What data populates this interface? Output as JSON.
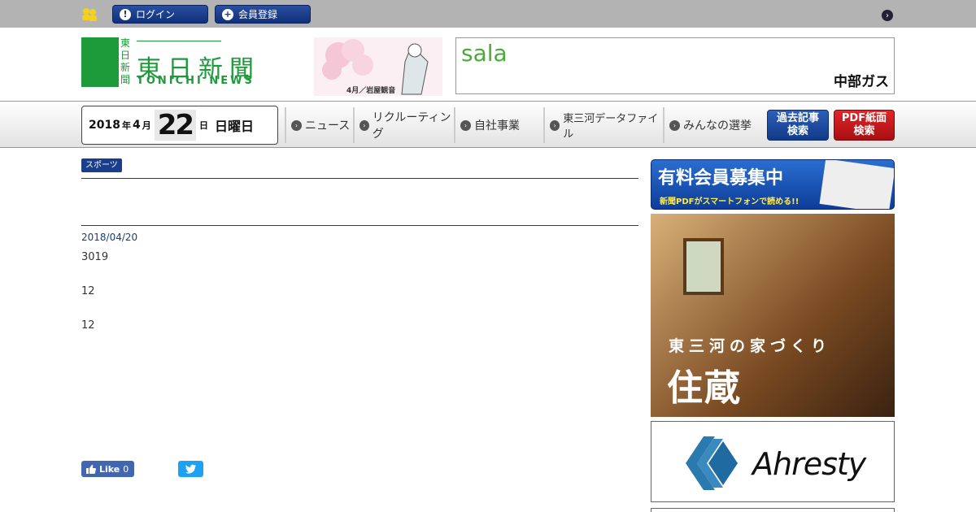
{
  "topbar": {
    "login_label": "ログイン",
    "register_label": "会員登録"
  },
  "logo": {
    "vertical": [
      "東",
      "日",
      "新",
      "聞"
    ],
    "main": "東日新聞",
    "sub": "TONICHI NEWS"
  },
  "illustration": {
    "caption": "4月／岩屋観音"
  },
  "banner": {
    "left_text": "sala",
    "right_text": "中部ガス"
  },
  "date": {
    "year": "2018",
    "year_suffix": "年",
    "month": "4",
    "month_suffix": "月",
    "day": "22",
    "day_suffix": "日",
    "weekday": "日曜日"
  },
  "nav": [
    {
      "label": "ニュース"
    },
    {
      "label": "リクルーティング"
    },
    {
      "label": "自社事業"
    },
    {
      "label": "東三河データファイル"
    },
    {
      "label": "みんなの選挙"
    }
  ],
  "search": {
    "old_line1": "過去記事",
    "old_line2": "検索",
    "pdf_line1": "PDF紙面",
    "pdf_line2": "検索"
  },
  "article": {
    "category": "スポーツ",
    "date": "2018/04/20",
    "paragraphs": [
      "3019",
      "12",
      "12"
    ],
    "like_label": "Like",
    "like_count": "0"
  },
  "sidebar": {
    "member_title": "有料会員募集中",
    "member_sub": "新聞PDFがスマートフォンで読める!!",
    "home_tagline": "東三河の家づくり",
    "home_name": "住蔵",
    "ahresty": "Ahresty"
  },
  "colors": {
    "brand_green": "#1d9a3a",
    "nav_blue": "#1a3d8c",
    "pdf_red": "#e0262a",
    "facebook": "#4267b2",
    "twitter": "#1da1f2"
  }
}
